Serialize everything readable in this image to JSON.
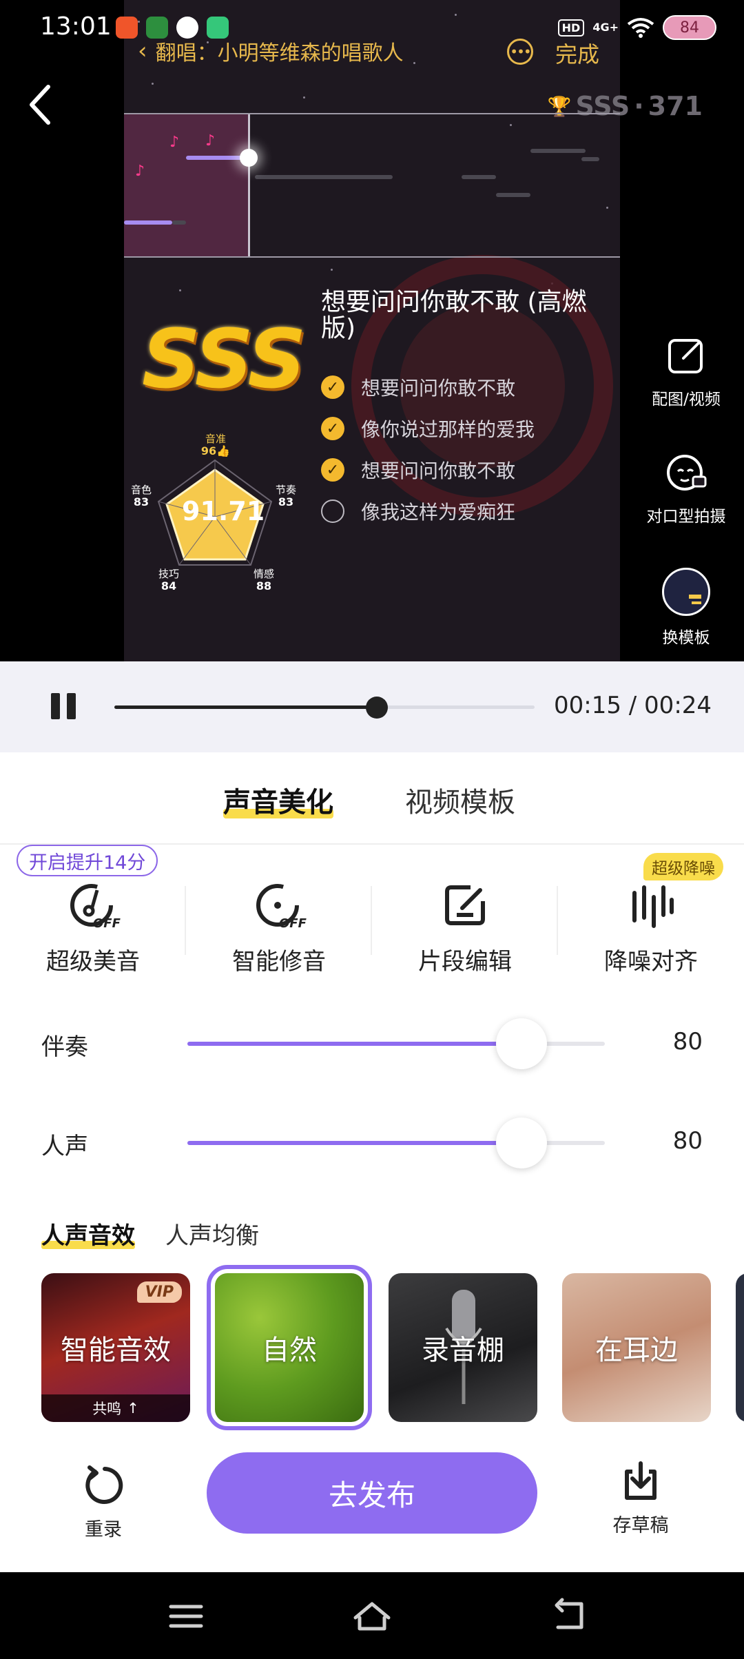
{
  "status_bar": {
    "time": "13:01",
    "hd": "HD",
    "network": "4G+",
    "battery": "84",
    "app_icons": [
      {
        "name": "app-icon-red",
        "color": "#f0552a"
      },
      {
        "name": "app-icon-video",
        "color": "#2d8f3e"
      },
      {
        "name": "chat-icon",
        "color": "#ffffff"
      },
      {
        "name": "app-icon-green",
        "color": "#35c77a"
      }
    ]
  },
  "header": {
    "song_title": "翻唱：小明等维森的唱歌人",
    "done_label": "完成",
    "rank": "SSS",
    "score": "371"
  },
  "result": {
    "grade": "SSS",
    "total_score": "91.71",
    "metrics": {
      "accuracy": {
        "label": "音准",
        "value": "96"
      },
      "rhythm": {
        "label": "节奏",
        "value": "83"
      },
      "emotion": {
        "label": "情感",
        "value": "88"
      },
      "skill": {
        "label": "技巧",
        "value": "84"
      },
      "timbre": {
        "label": "音色",
        "value": "83"
      }
    },
    "lyric_title": "想要问问你敢不敢 (高燃版)",
    "lyrics": [
      {
        "text": "想要问问你敢不敢",
        "checked": true
      },
      {
        "text": "像你说过那样的爱我",
        "checked": true
      },
      {
        "text": "想要问问你敢不敢",
        "checked": true
      },
      {
        "text": "像我这样为爱痴狂",
        "checked": false
      }
    ]
  },
  "side_tools": [
    {
      "label": "配图/视频",
      "icon": "edit-image-icon"
    },
    {
      "label": "对口型拍摄",
      "icon": "lip-sync-camera-icon"
    },
    {
      "label": "换模板",
      "icon": "template-thumbnail"
    }
  ],
  "playback": {
    "current": "00:15",
    "total": "00:24",
    "progress": 0.625,
    "time_text": "00:15 / 00:24"
  },
  "tabs": [
    {
      "label": "声音美化",
      "active": true
    },
    {
      "label": "视频模板",
      "active": false
    }
  ],
  "tools": {
    "boost_badge": "开启提升14分",
    "noise_badge": "超级降噪",
    "items": [
      {
        "label": "超级美音",
        "icon": "super-voice-off-icon"
      },
      {
        "label": "智能修音",
        "icon": "smart-tune-off-icon"
      },
      {
        "label": "片段编辑",
        "icon": "clip-edit-icon"
      },
      {
        "label": "降噪对齐",
        "icon": "denoise-align-icon"
      }
    ]
  },
  "sliders": {
    "accompaniment": {
      "label": "伴奏",
      "value": 80,
      "display": "80",
      "max": 100
    },
    "vocal": {
      "label": "人声",
      "value": 80,
      "display": "80",
      "max": 100
    }
  },
  "effects": {
    "tabs": [
      {
        "label": "人声音效",
        "active": true
      },
      {
        "label": "人声均衡",
        "active": false
      }
    ],
    "cards": [
      {
        "label": "智能音效",
        "vip": "VIP",
        "sub": "共鸣",
        "selected": false
      },
      {
        "label": "自然",
        "selected": true
      },
      {
        "label": "录音棚",
        "selected": false
      },
      {
        "label": "在耳边",
        "selected": false
      }
    ]
  },
  "actions": {
    "rerecord": "重录",
    "publish": "去发布",
    "draft": "存草稿"
  },
  "colors": {
    "accent": "#8e6cf0",
    "highlight": "#f9dc4b",
    "gold": "#e7b84c"
  }
}
